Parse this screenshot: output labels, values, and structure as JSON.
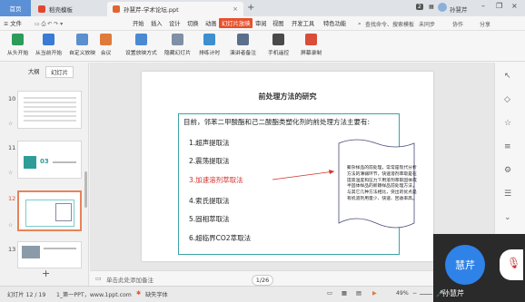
{
  "tabbar": {
    "home_label": "首页",
    "tab1_label": "稻壳模板",
    "tab2_label": "孙慧芹-学术论坛.ppt",
    "plus": "+",
    "page_count": "2",
    "user_name": "孙慧芹"
  },
  "menubar": {
    "file": "≡ 文件",
    "items": [
      "开始",
      "插入",
      "设计",
      "切换",
      "动画",
      "幻灯片放映",
      "审阅",
      "视图",
      "开发工具",
      "特色功能"
    ],
    "active_index": 5,
    "search": "查找命令、搜索模板",
    "sync": "未同步",
    "collab": "协作",
    "share": "分享"
  },
  "ribbon": {
    "buttons": [
      "从头开始",
      "从当前开始",
      "自定义放映",
      "会议",
      "设置放映方式",
      "隐藏幻灯片",
      "排练计时",
      "演讲者备注",
      "手机遥控",
      "屏幕录制"
    ]
  },
  "leftpanel": {
    "tab_outline": "大纲",
    "tab_slides": "幻灯片",
    "thumbs": [
      {
        "num": "10"
      },
      {
        "num": "11",
        "text": "03"
      },
      {
        "num": "12"
      },
      {
        "num": "13"
      }
    ],
    "add": "+"
  },
  "slide": {
    "title": "前处理方法的研究",
    "intro": "目前，邻苯二甲酸酯和己二酸酯类塑化剂的前处理方法主要有:",
    "methods": [
      "1.超声提取法",
      "2.震荡提取法",
      "3.加速溶剂萃取法",
      "4.索氏提取法",
      "5.固相萃取法",
      "6.超临界CO2萃取法"
    ],
    "highlight_index": 2,
    "note": "聚杂样品的前处理，常常是现代分析方法的薄弱环节，快速溶剂萃取是在提高温度和压力下用溶剂萃取固体或半固体样品的新颖样品前处理方法，与其它几种方法相比，突出的优点是有机溶剂用量少、快速、回收率高。"
  },
  "notes": {
    "placeholder": "单击此处添加备注",
    "page": "1/26"
  },
  "statusbar": {
    "slide_info": "幻灯片 12 / 19",
    "template": "1_第一PPT，www.1ppt.com",
    "font_missing": "缺失字体",
    "zoom": "49%"
  },
  "video": {
    "avatar_text": "慧芹",
    "name": "孙慧芹"
  },
  "colors": {
    "accent": "#e7502b",
    "highlight_text": "#d2312b",
    "frame": "#3ba3a3",
    "avatar": "#2f82e8"
  }
}
